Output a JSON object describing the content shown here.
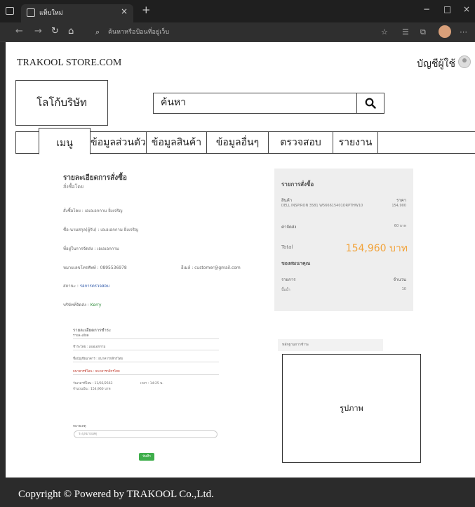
{
  "browser": {
    "tab_title": "แท็บใหม่",
    "tab_close": "×",
    "new_tab": "+",
    "omnibox_placeholder": "ค้นหาหรือป้อนที่อยู่เว็บ",
    "window_controls": [
      "−",
      "□",
      "×"
    ],
    "nav_icons": [
      "back-arrow-icon",
      "forward-arrow-icon",
      "refresh-icon",
      "home-icon"
    ]
  },
  "header": {
    "site_name": "TRAKOOL STORE.COM",
    "account_label": "บัญชีผู้ใช้"
  },
  "logo_label": "โลโก้บริษัท",
  "search": {
    "value": "ค้นหา"
  },
  "menu": {
    "items": [
      "เมนู",
      "ข้อมูลส่วนตัว",
      "ข้อมูลสินค้า",
      "ข้อมูลอื่นๆ",
      "ตรวจสอบ",
      "รายงาน"
    ]
  },
  "order_detail": {
    "title": "รายละเอียดการสั่งซื้อ",
    "subtitle": "สั่งซื้อโดย",
    "rows": [
      "สั่งซื้อโดย : เอเอเอกกาม ยิ่งเจริญ",
      "ชื่อ-นามสกุล(ผู้รับ) : เอเอเอกกาม ยิ่งเจริญ",
      "ที่อยู่ในการจัดส่ง : เอเอเอกกาม",
      "หมายเลขโทรศัพท์ : 0895536978"
    ],
    "email": "อีเมล์ : customer@gmail.com",
    "status_label": "สถานะ : ",
    "status_value": "รอการตรวจสอบ",
    "shipping_label": "บริษัทที่จัดส่ง : ",
    "shipping_value": "Kerry"
  },
  "payment": {
    "title": "รายละเอียดการชำระ",
    "subtitle": "รายละเอียด",
    "lines": [
      "ชำระโดย : เอเอเอกกาม",
      "ชื่อบัญชีธนาคาร : ธนาคารกสิกรไทย",
      "ธนาคารที่โอน : ธนาคารกสิกรไทย",
      "วันเวลาที่โอน : 11/02/2563",
      "จำนวนเงิน : 154,960 บาท"
    ],
    "time_label": "เวลา : 14:25 น.",
    "note_label": "หมายเหตุ",
    "note_placeholder": "ระบุหมายเหตุ",
    "save_label": "บันทึก"
  },
  "summary": {
    "title": "รายการสั่งซื้อ",
    "product_label": "สินค้า",
    "price_label": "ราคา",
    "product_name": "DELL INSPIRON 3581 W566615401ORPTHW10",
    "product_price": "154,900",
    "shipping_label": "ค่าจัดส่ง",
    "shipping_value": "60 บาท",
    "total_label": "Total",
    "total_value": "154,960 บาท",
    "gift_title": "ของสมนาคุณ",
    "list_label": "รายการ",
    "qty_label": "จำนวน",
    "gift_item": "ปั๊มน้ำ",
    "gift_qty": "10"
  },
  "slip": {
    "label": "หลักฐานการชำระ",
    "image_label": "รูปภาพ"
  },
  "footer": {
    "text": "Copyright © Powered by TRAKOOL Co.,Ltd."
  }
}
